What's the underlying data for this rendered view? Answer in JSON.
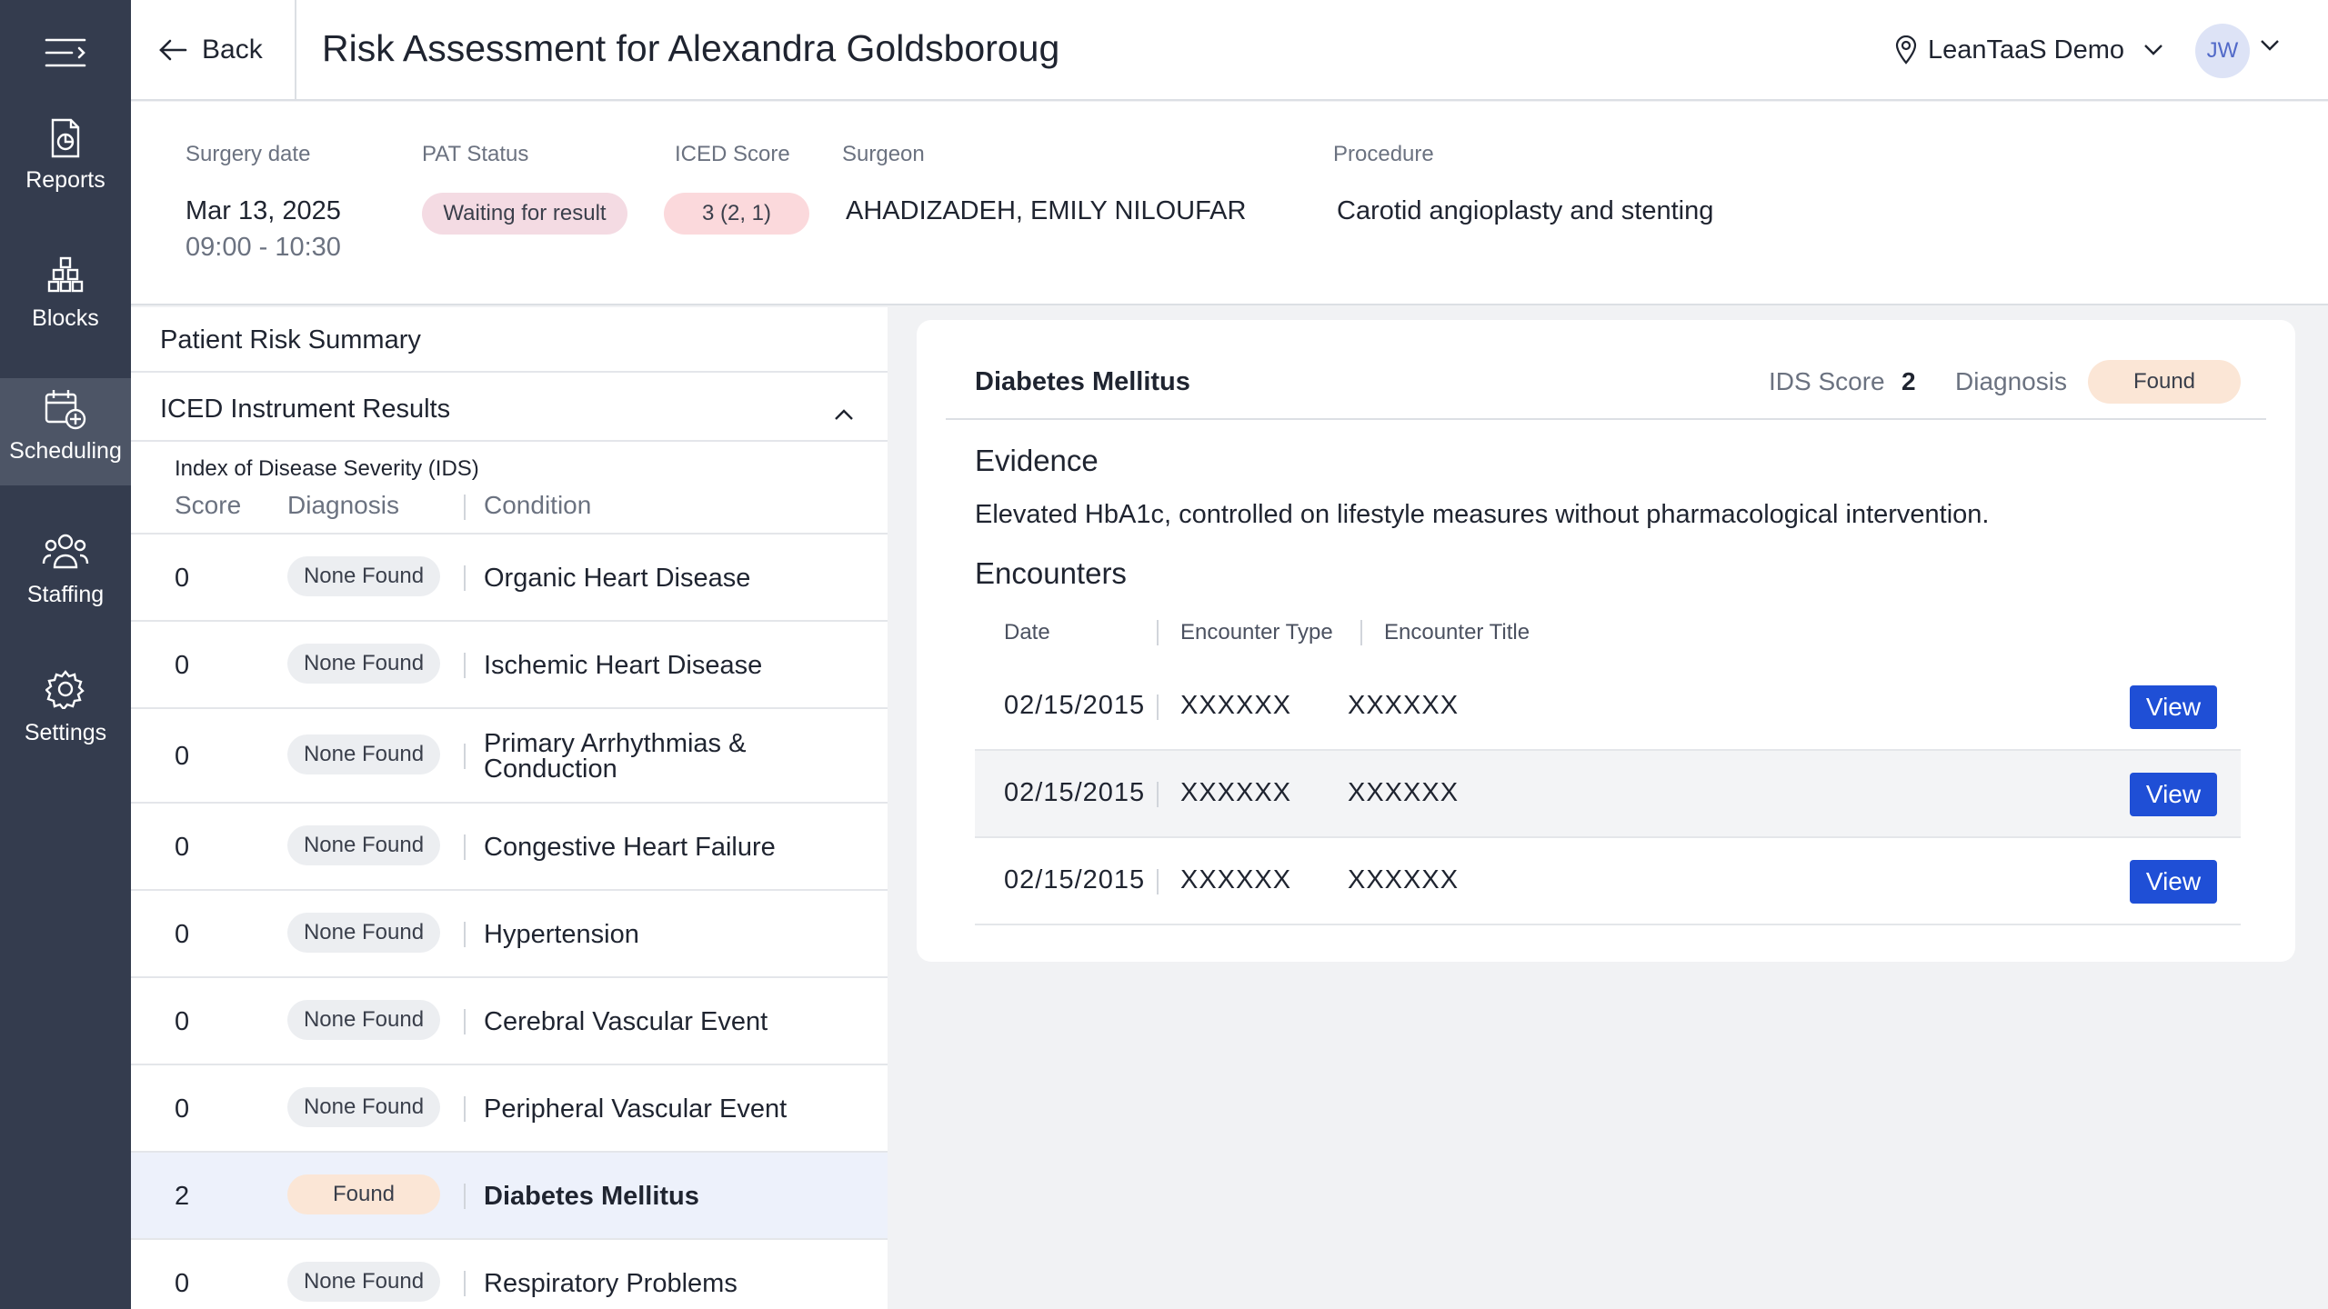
{
  "sidebar": {
    "items": [
      {
        "label": "Reports",
        "icon": "reports-icon"
      },
      {
        "label": "Blocks",
        "icon": "blocks-icon"
      },
      {
        "label": "Scheduling",
        "icon": "scheduling-icon",
        "active": true
      },
      {
        "label": "Staffing",
        "icon": "staffing-icon"
      },
      {
        "label": "Settings",
        "icon": "settings-icon"
      }
    ]
  },
  "header": {
    "back_label": "Back",
    "title": "Risk Assessment for Alexandra Goldsboroug",
    "location": "LeanTaaS Demo",
    "avatar_initials": "JW"
  },
  "info": {
    "surgery_date_label": "Surgery date",
    "surgery_date": "Mar 13, 2025",
    "surgery_time": "09:00 - 10:30",
    "pat_status_label": "PAT Status",
    "pat_status": "Waiting for result",
    "iced_score_label": "ICED Score",
    "iced_score": "3 (2, 1)",
    "surgeon_label": "Surgeon",
    "surgeon": "AHADIZADEH, EMILY NILOUFAR",
    "procedure_label": "Procedure",
    "procedure": "Carotid angioplasty and stenting"
  },
  "left": {
    "summary_label": "Patient Risk Summary",
    "iced_label": "ICED Instrument Results",
    "ids_title": "Index of Disease Severity (IDS)",
    "col_score": "Score",
    "col_diagnosis": "Diagnosis",
    "col_condition": "Condition",
    "conditions": [
      {
        "score": "0",
        "diagnosis": "None Found",
        "condition": "Organic Heart Disease"
      },
      {
        "score": "0",
        "diagnosis": "None Found",
        "condition": "Ischemic Heart Disease"
      },
      {
        "score": "0",
        "diagnosis": "None Found",
        "condition": "Primary Arrhythmias & Conduction"
      },
      {
        "score": "0",
        "diagnosis": "None Found",
        "condition": "Congestive Heart Failure"
      },
      {
        "score": "0",
        "diagnosis": "None Found",
        "condition": "Hypertension"
      },
      {
        "score": "0",
        "diagnosis": "None Found",
        "condition": "Cerebral Vascular Event"
      },
      {
        "score": "0",
        "diagnosis": "None Found",
        "condition": "Peripheral Vascular Event"
      },
      {
        "score": "2",
        "diagnosis": "Found",
        "condition": "Diabetes Mellitus",
        "selected": true
      },
      {
        "score": "0",
        "diagnosis": "None Found",
        "condition": "Respiratory Problems"
      }
    ]
  },
  "detail": {
    "title": "Diabetes Mellitus",
    "ids_score_label": "IDS Score",
    "ids_score": "2",
    "diagnosis_label": "Diagnosis",
    "diagnosis": "Found",
    "evidence_heading": "Evidence",
    "evidence_text": "Elevated HbA1c, controlled on lifestyle measures without pharmacological intervention.",
    "encounters_heading": "Encounters",
    "col_date": "Date",
    "col_type": "Encounter Type",
    "col_title": "Encounter Title",
    "view_label": "View",
    "encounters": [
      {
        "date": "02/15/2015",
        "type": "XXXXXX",
        "title": "XXXXXX"
      },
      {
        "date": "02/15/2015",
        "type": "XXXXXX",
        "title": "XXXXXX"
      },
      {
        "date": "02/15/2015",
        "type": "XXXXXX",
        "title": "XXXXXX"
      }
    ]
  },
  "colors": {
    "sidebar_bg": "#343c4e",
    "sidebar_active": "#4d5566",
    "primary_button": "#1f4fd6",
    "found_badge": "#fbe6d6",
    "waiting_badge": "#f4dbe3",
    "iced_badge": "#fbd9dc",
    "selected_row": "#edf1fb"
  }
}
